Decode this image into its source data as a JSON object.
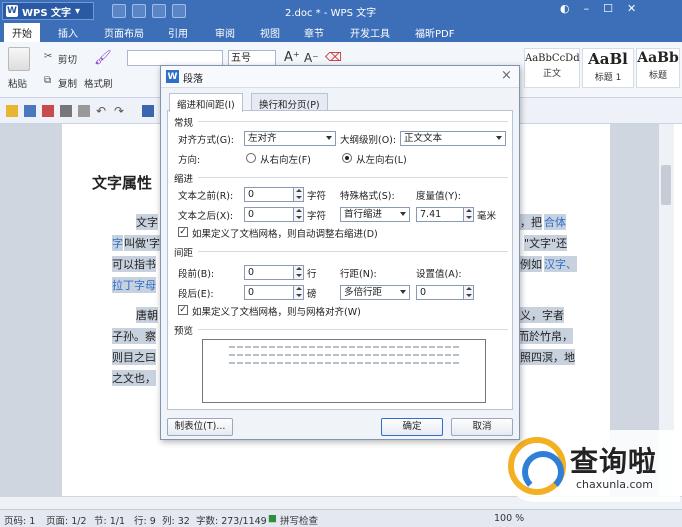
{
  "app": {
    "name": "WPS 文字",
    "doc_title": "2.doc * - WPS 文字",
    "logo_glyph": "W"
  },
  "tabs": [
    "开始",
    "插入",
    "页面布局",
    "引用",
    "审阅",
    "视图",
    "章节",
    "开发工具",
    "福昕PDF"
  ],
  "ribbon": {
    "paste": "粘贴",
    "cut": "剪切",
    "copy": "复制",
    "format_painter": "格式刷",
    "font_size": "五号",
    "styles": [
      {
        "sample": "AaBbCcDd",
        "name": "正文"
      },
      {
        "sample": "AaBl",
        "name": "标题 1"
      },
      {
        "sample": "AaBb",
        "name": "标题"
      }
    ]
  },
  "document": {
    "heading": "文字属性",
    "lines": [
      {
        "a": "文字",
        "b": "，把",
        "c": "合体"
      },
      {
        "a": "字",
        "b": "叫做'字",
        "c": "\"文字\"还"
      },
      {
        "a": "可以指书",
        "c": "例如",
        "d": "汉字、"
      },
      {
        "a": "拉丁字母"
      },
      {
        "a": "唐朝",
        "c": "义，字者"
      },
      {
        "a": "子孙。察",
        "c": "而於竹帛，"
      },
      {
        "a": "则目之曰",
        "c": "照四溟，地"
      },
      {
        "a": "之文也，"
      }
    ]
  },
  "dialog": {
    "title": "段落",
    "close": "×",
    "tabs": [
      "缩进和间距(I)",
      "换行和分页(P)"
    ],
    "general": {
      "section": "常规",
      "alignment_label": "对齐方式(G):",
      "alignment_value": "左对齐",
      "outline_label": "大纲级别(O):",
      "outline_value": "正文文本",
      "direction_label": "方向:",
      "rtl": "从右向左(F)",
      "ltr": "从左向右(L)"
    },
    "indent": {
      "section": "缩进",
      "before_label": "文本之前(R):",
      "before_value": "0",
      "before_unit": "字符",
      "after_label": "文本之后(X):",
      "after_value": "0",
      "after_unit": "字符",
      "special_label": "特殊格式(S):",
      "special_value": "首行缩进",
      "measure_label": "度量值(Y):",
      "measure_value": "7.41",
      "measure_unit": "毫米",
      "grid_check": "如果定义了文档网格，则自动调整右缩进(D)"
    },
    "spacing": {
      "section": "间距",
      "before_label": "段前(B):",
      "before_value": "0",
      "before_unit": "行",
      "after_label": "段后(E):",
      "after_value": "0",
      "after_unit": "磅",
      "line_label": "行距(N):",
      "line_value": "多倍行距",
      "set_label": "设置值(A):",
      "set_value": "0",
      "grid_check": "如果定义了文档网格，则与网格对齐(W)"
    },
    "preview_label": "预览",
    "buttons": {
      "tabs": "制表位(T)...",
      "ok": "确定",
      "cancel": "取消"
    }
  },
  "status": {
    "page": "页码: 1",
    "pages": "页面: 1/2",
    "section": "节: 1/1",
    "row": "行: 9",
    "col": "列: 32",
    "words": "字数: 273/1149",
    "spell": "拼写检查",
    "zoom": "100 %"
  },
  "watermark": {
    "cn": "查询啦",
    "en": "chaxunla.com"
  },
  "colors": {
    "titlebar": "#3c6fb8",
    "accent": "#2f6fc9",
    "highlight": "#c8d2de"
  }
}
